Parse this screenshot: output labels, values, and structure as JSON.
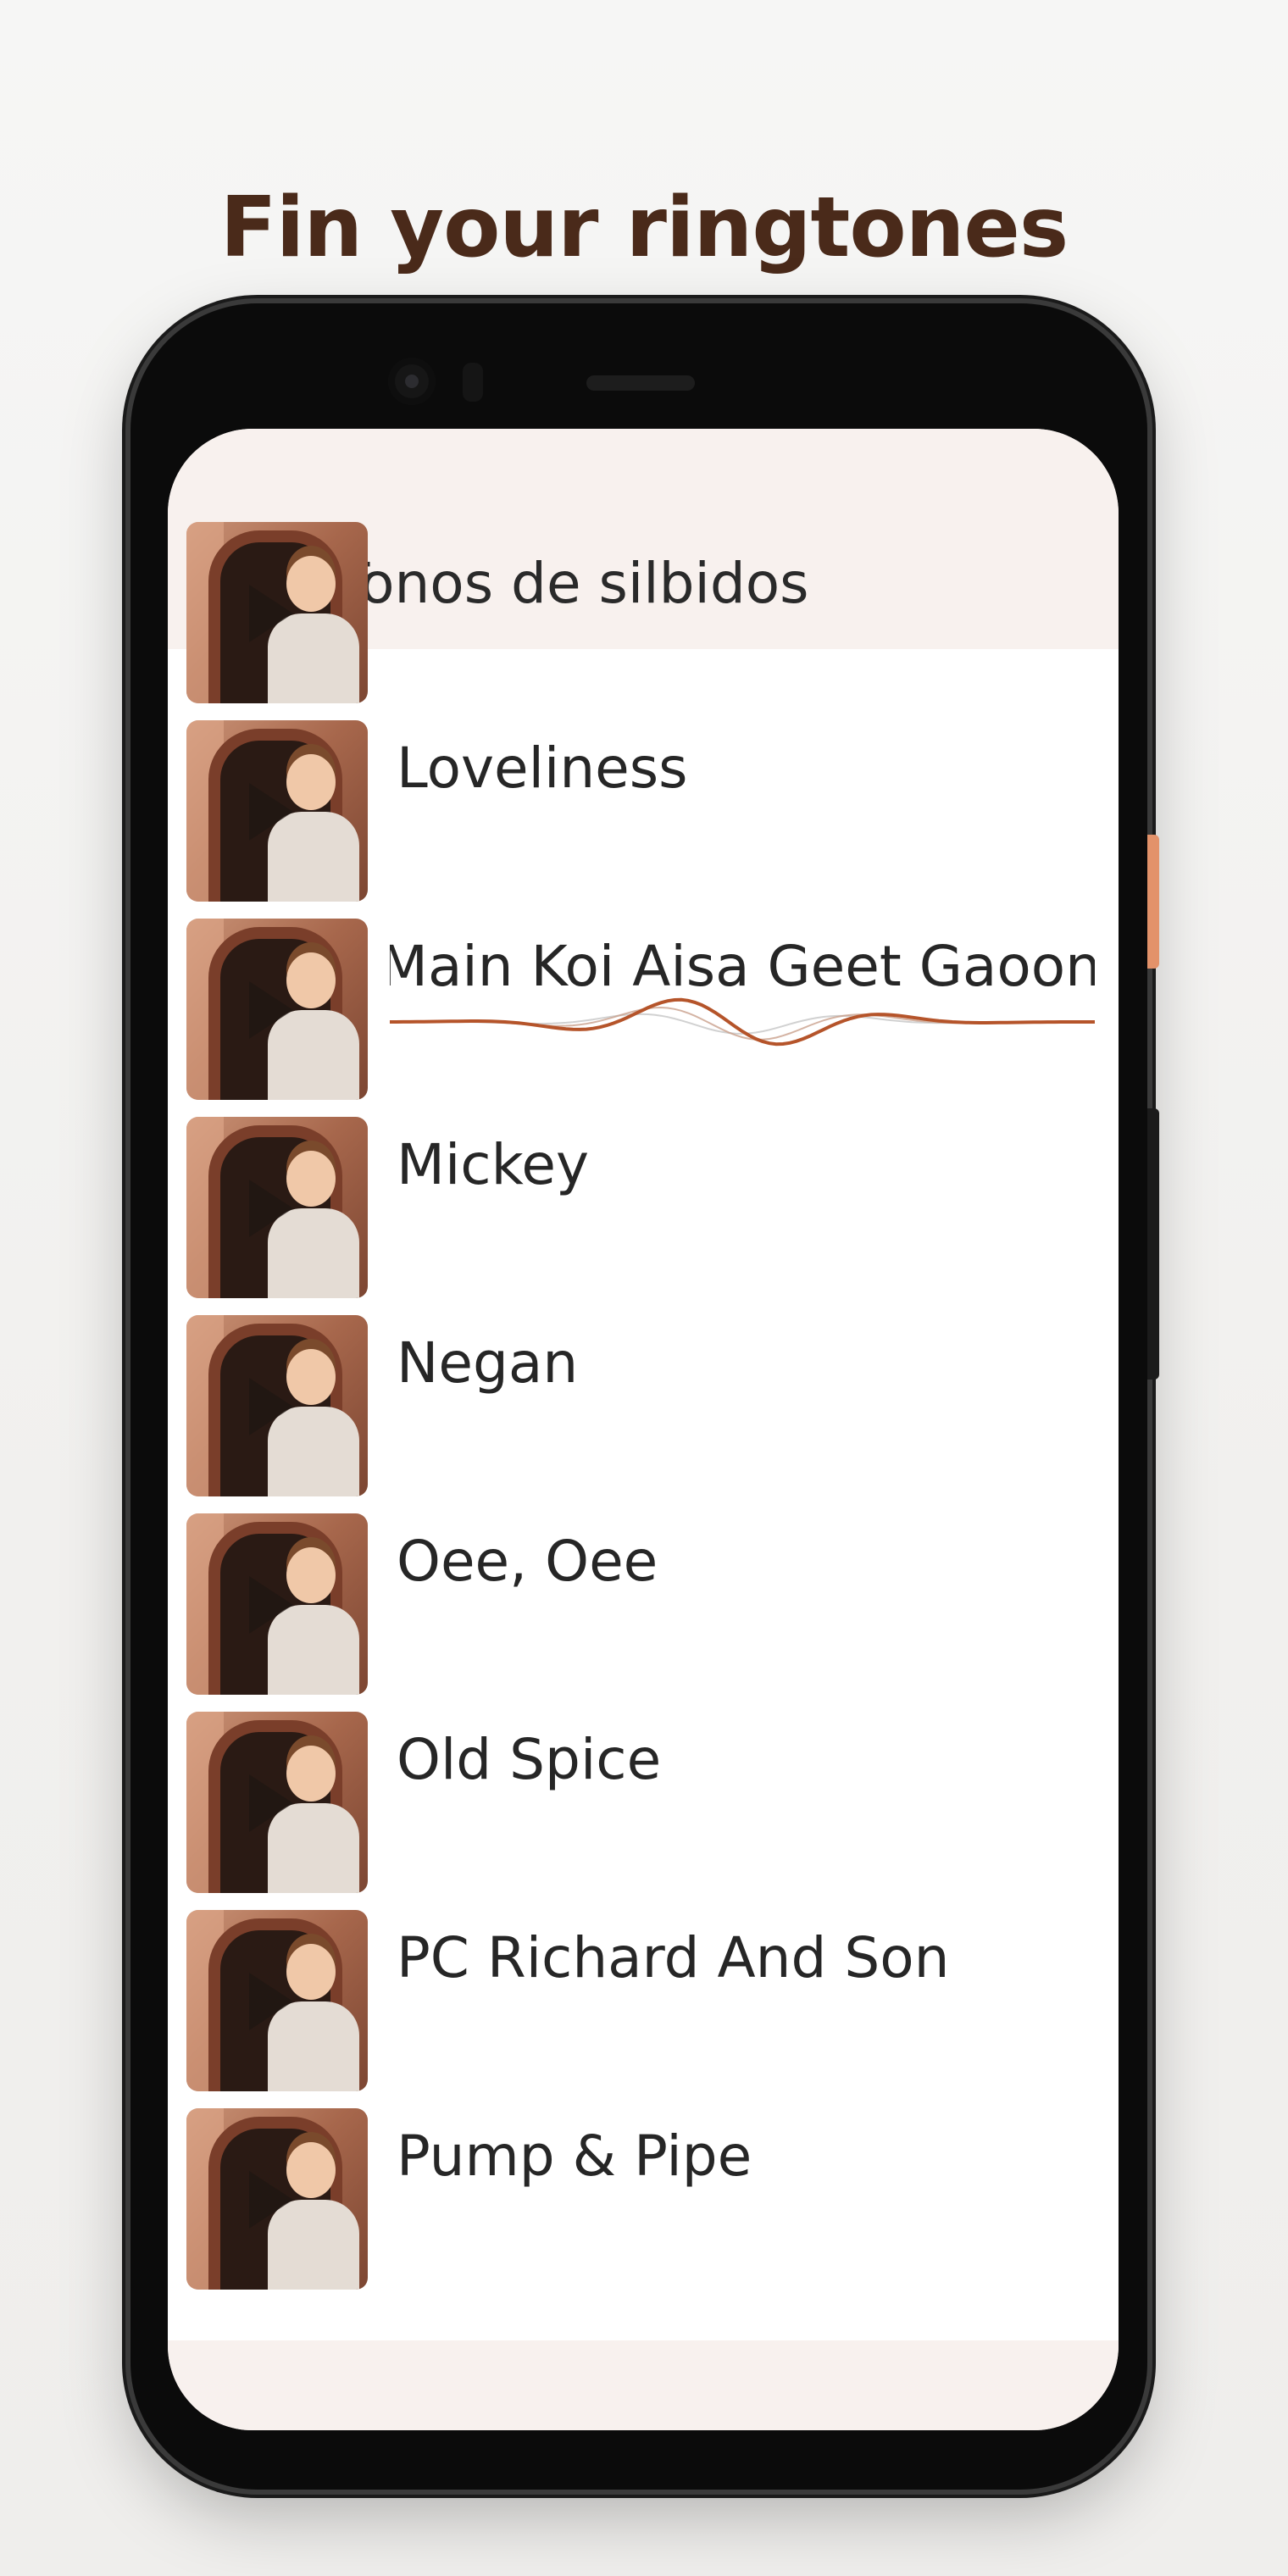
{
  "promo": {
    "headline": "Fin your ringtones"
  },
  "appbar": {
    "title": "Tonos de silbidos",
    "menu_icon": "hamburger-menu-icon"
  },
  "ringtones": [
    {
      "title": "Loveliness",
      "playing": false
    },
    {
      "title": "Main Koi Aisa Geet Gaoon",
      "playing": true
    },
    {
      "title": "Mickey",
      "playing": false
    },
    {
      "title": "Negan",
      "playing": false
    },
    {
      "title": "Oee, Oee",
      "playing": false
    },
    {
      "title": "Old Spice",
      "playing": false
    },
    {
      "title": "PC Richard And Son",
      "playing": false
    },
    {
      "title": "Pump & Pipe",
      "playing": false
    }
  ],
  "colors": {
    "headline": "#4a2a1a",
    "appbar_bg": "#f8f1ee",
    "wave": "#b5542a",
    "accent_button": "#e3926a"
  }
}
